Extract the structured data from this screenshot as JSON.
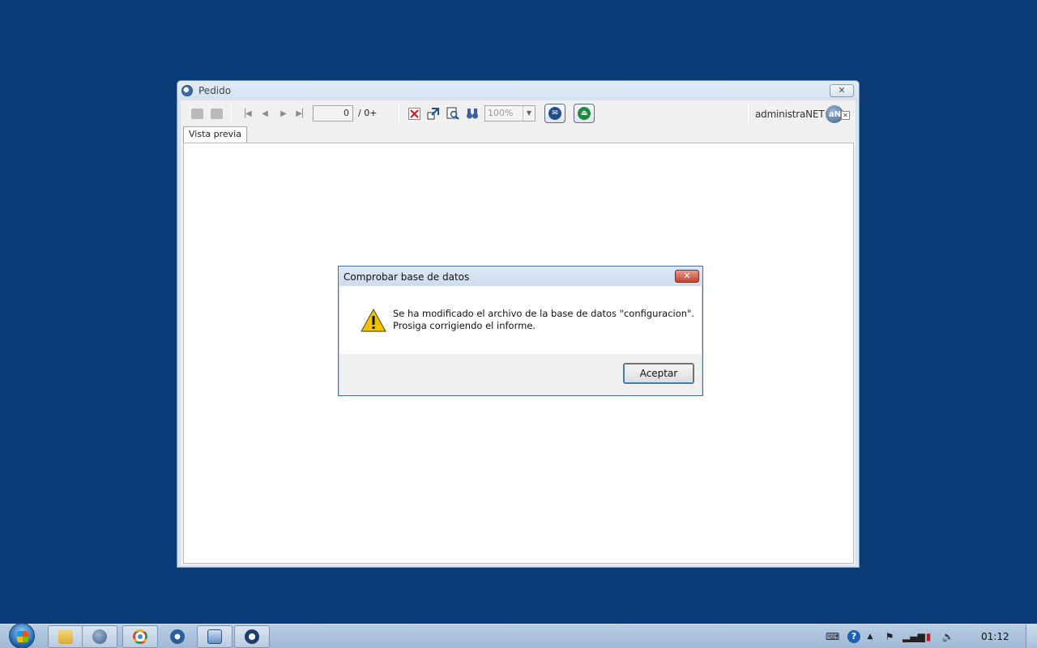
{
  "window": {
    "title": "Pedido",
    "close_glyph": "✕",
    "toolbar": {
      "page_current": "0",
      "page_total": "/ 0+",
      "zoom_value": "100%",
      "icons": [
        "copy-icon",
        "print-icon",
        "first-page-icon",
        "prev-page-icon",
        "next-page-icon",
        "last-page-icon",
        "close-report-icon",
        "export-icon",
        "find-icon",
        "binoculars-icon",
        "email-icon",
        "exit-icon"
      ],
      "brand_text": "administraNET",
      "brand_logo": "aN"
    },
    "tab_label": "Vista previa"
  },
  "dialog": {
    "title": "Comprobar base de datos",
    "close_glyph": "✕",
    "message_line1": "Se ha modificado el archivo de la base de datos \"configuracion\".",
    "message_line2": "Prosiga corrigiendo el informe.",
    "ok_label": "Aceptar",
    "icon": "warning-icon"
  },
  "taskbar": {
    "clock": "01:12",
    "items": [
      "explorer-icon",
      "administranet-icon",
      "chrome-icon",
      "settings-icon",
      "monitor-icon",
      "app-icon"
    ]
  },
  "colors": {
    "desktop": "#0b3b74",
    "accent": "#3c7fb1",
    "dialog_close": "#c7432e"
  }
}
